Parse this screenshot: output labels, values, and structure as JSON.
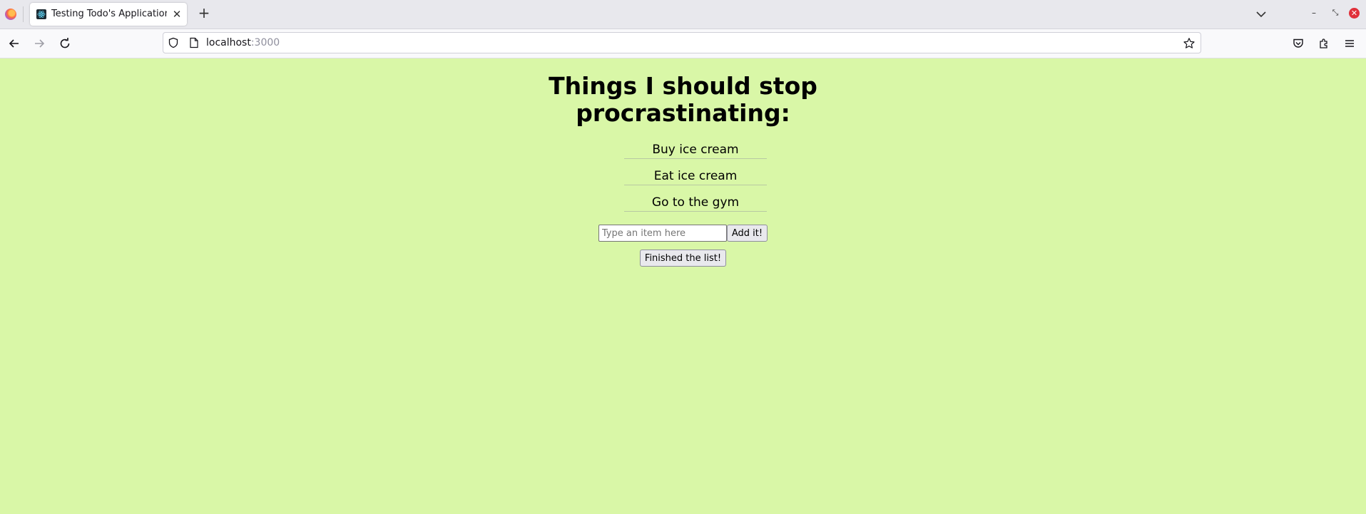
{
  "browser": {
    "tab": {
      "title": "Testing Todo's Application",
      "close_glyph": "✕"
    },
    "new_tab_glyph": "+",
    "window": {
      "minimize_glyph": "–",
      "maximize_glyph": "⤡",
      "close_glyph": "✕"
    },
    "url": {
      "host": "localhost",
      "port": ":3000"
    },
    "icons": {
      "back": "back-arrow-icon",
      "forward": "forward-arrow-icon",
      "reload": "reload-icon",
      "shield": "tracking-protection-shield-icon",
      "page": "page-info-icon",
      "bookmark": "bookmark-star-icon",
      "pocket": "pocket-icon",
      "extensions": "extensions-puzzle-icon",
      "menu": "hamburger-menu-icon",
      "tab_list": "chevron-down-icon"
    }
  },
  "app": {
    "title": "Things I should stop procrastinating:",
    "items": [
      "Buy ice cream",
      "Eat ice cream",
      "Go to the gym"
    ],
    "input_placeholder": "Type an item here",
    "add_button_label": "Add it!",
    "finish_button_label": "Finished the list!",
    "background_color": "#d9f7a7"
  }
}
